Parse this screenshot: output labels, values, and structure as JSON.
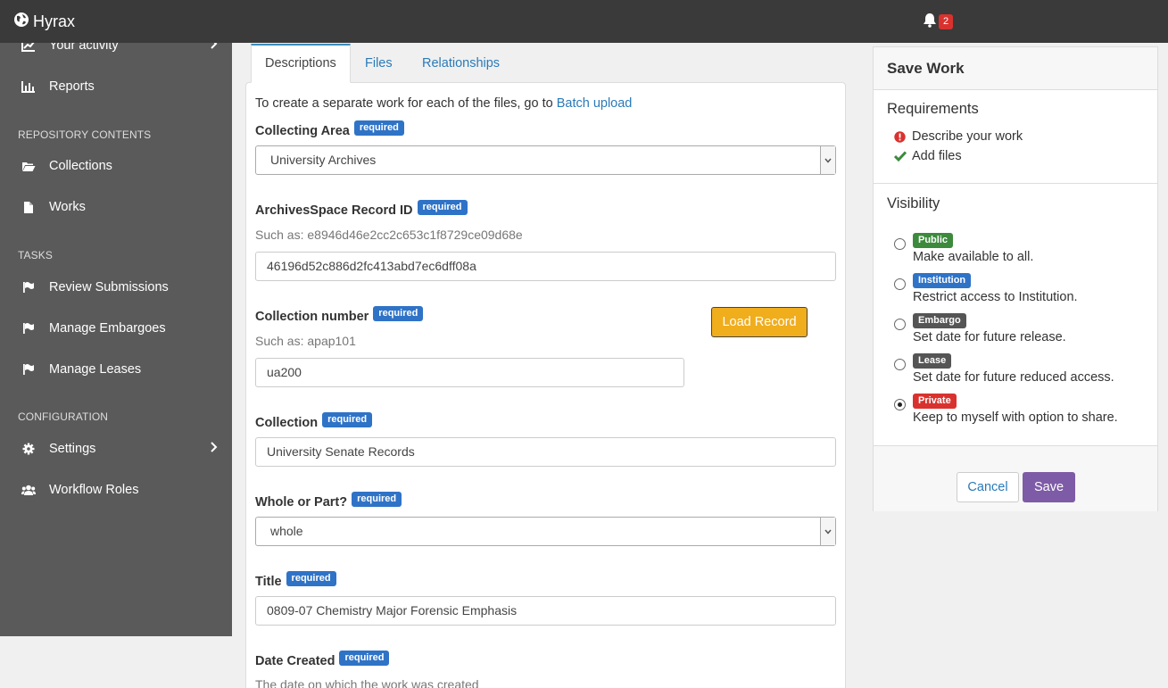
{
  "app": {
    "name": "Hyrax",
    "notification_count": "2"
  },
  "sidebar": {
    "items": [
      {
        "label": "Your activity",
        "icon": "line-chart-icon",
        "has_chevron": true
      },
      {
        "label": "Reports",
        "icon": "bar-chart-icon"
      },
      {
        "label": "Collections",
        "icon": "folder-open-icon"
      },
      {
        "label": "Works",
        "icon": "file-icon"
      },
      {
        "label": "Review Submissions",
        "icon": "flag-icon"
      },
      {
        "label": "Manage Embargoes",
        "icon": "flag-icon"
      },
      {
        "label": "Manage Leases",
        "icon": "flag-icon"
      },
      {
        "label": "Settings",
        "icon": "gear-icon",
        "has_chevron": true
      },
      {
        "label": "Workflow Roles",
        "icon": "users-icon"
      }
    ],
    "sections": {
      "repository": "REPOSITORY CONTENTS",
      "tasks": "TASKS",
      "configuration": "CONFIGURATION"
    }
  },
  "tabs": [
    {
      "label": "Descriptions",
      "active": true
    },
    {
      "label": "Files"
    },
    {
      "label": "Relationships"
    }
  ],
  "form": {
    "intro_text": "To create a separate work for each of the files, go to ",
    "intro_link": "Batch upload",
    "required_badge": "required",
    "collecting_area": {
      "label": "Collecting Area",
      "value": "University Archives"
    },
    "archivesspace_id": {
      "label": "ArchivesSpace Record ID",
      "hint": "Such as: e8946d46e2cc2c653c1f8729ce09d68e",
      "value": "46196d52c886d2fc413abd7ec6dff08a"
    },
    "collection_number": {
      "label": "Collection number",
      "hint": "Such as: apap101",
      "value": "ua200"
    },
    "load_record": "Load Record",
    "collection": {
      "label": "Collection",
      "value": "University Senate Records"
    },
    "whole_or_part": {
      "label": "Whole or Part?",
      "value": "whole"
    },
    "title": {
      "label": "Title",
      "value": "0809-07 Chemistry Major Forensic Emphasis"
    },
    "date_created": {
      "label": "Date Created",
      "hint": "The date on which the work was created"
    }
  },
  "save_panel": {
    "title": "Save Work",
    "requirements_heading": "Requirements",
    "requirements": [
      {
        "label": "Describe your work",
        "status": "incomplete"
      },
      {
        "label": "Add files",
        "status": "complete"
      }
    ],
    "visibility_heading": "Visibility",
    "visibility": [
      {
        "badge": "Public",
        "desc": "Make available to all.",
        "color": "#3c8a3c"
      },
      {
        "badge": "Institution",
        "desc": "Restrict access to Institution.",
        "color": "#2f73c7"
      },
      {
        "badge": "Embargo",
        "desc": "Set date for future release.",
        "color": "#555555"
      },
      {
        "badge": "Lease",
        "desc": "Set date for future reduced access.",
        "color": "#555555"
      },
      {
        "badge": "Private",
        "desc": "Keep to myself with option to share.",
        "color": "#d9322e",
        "selected": true
      }
    ],
    "cancel": "Cancel",
    "save": "Save"
  },
  "colors": {
    "navbar": "#3a3a3a",
    "sidebar": "#5a5a5a",
    "link": "#2a7ab8",
    "required": "#2f73c7",
    "load_button": "#f0ad1c",
    "save_button": "#7e5ba7"
  }
}
